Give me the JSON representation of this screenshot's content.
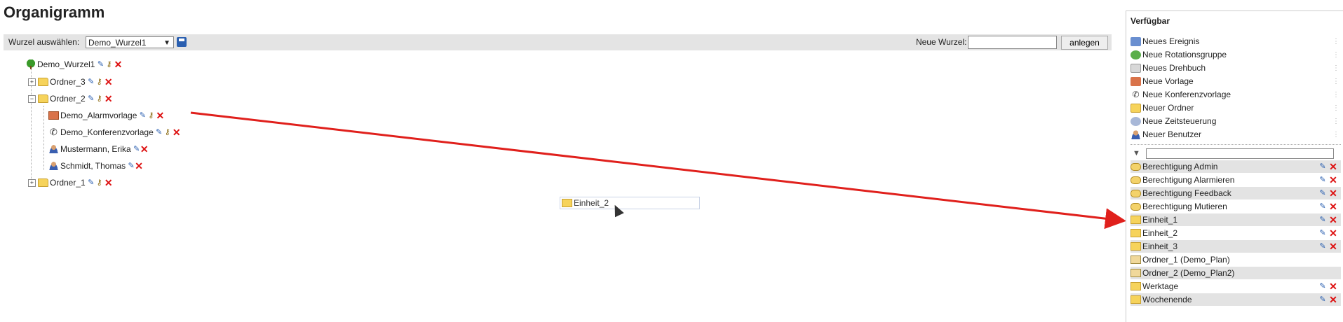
{
  "page": {
    "title": "Organigramm"
  },
  "toolbar": {
    "root_label": "Wurzel auswählen:",
    "root_value": "Demo_Wurzel1",
    "new_root_label": "Neue Wurzel:",
    "new_root_value": "",
    "create_label": "anlegen"
  },
  "tree": {
    "root": "Demo_Wurzel1",
    "ordner3": "Ordner_3",
    "ordner2": "Ordner_2",
    "alarmvorlage": "Demo_Alarmvorlage",
    "konferenzvorlage": "Demo_Konferenzvorlage",
    "user1": "Mustermann, Erika",
    "user2": "Schmidt, Thomas",
    "ordner1": "Ordner_1",
    "toggle_plus": "+",
    "toggle_minus": "−"
  },
  "drag": {
    "label": "Einheit_2"
  },
  "annotation": {
    "arrow_color": "#e0201c"
  },
  "panel": {
    "title": "Verfügbar",
    "available": [
      {
        "label": "Neues Ereignis",
        "icon": "event-icon"
      },
      {
        "label": "Neue Rotationsgruppe",
        "icon": "rotation-icon"
      },
      {
        "label": "Neues Drehbuch",
        "icon": "script-icon"
      },
      {
        "label": "Neue Vorlage",
        "icon": "template-icon"
      },
      {
        "label": "Neue Konferenzvorlage",
        "icon": "conference-icon"
      },
      {
        "label": "Neuer Ordner",
        "icon": "new-folder-icon"
      },
      {
        "label": "Neue Zeitsteuerung",
        "icon": "timer-icon"
      },
      {
        "label": "Neuer Benutzer",
        "icon": "user-icon"
      }
    ],
    "filter_value": "",
    "items": [
      {
        "label": "Berechtigung Admin",
        "icon": "key-icon"
      },
      {
        "label": "Berechtigung Alarmieren",
        "icon": "key-icon"
      },
      {
        "label": "Berechtigung Feedback",
        "icon": "key-icon"
      },
      {
        "label": "Berechtigung Mutieren",
        "icon": "key-icon"
      },
      {
        "label": "Einheit_1",
        "icon": "folder-icon"
      },
      {
        "label": "Einheit_2",
        "icon": "folder-icon"
      },
      {
        "label": "Einheit_3",
        "icon": "folder-icon"
      },
      {
        "label": "Ordner_1 (Demo_Plan)",
        "icon": "plan-icon"
      },
      {
        "label": "Ordner_2 (Demo_Plan2)",
        "icon": "plan-icon"
      },
      {
        "label": "Werktage",
        "icon": "folder-icon"
      },
      {
        "label": "Wochenende",
        "icon": "folder-icon"
      }
    ]
  }
}
